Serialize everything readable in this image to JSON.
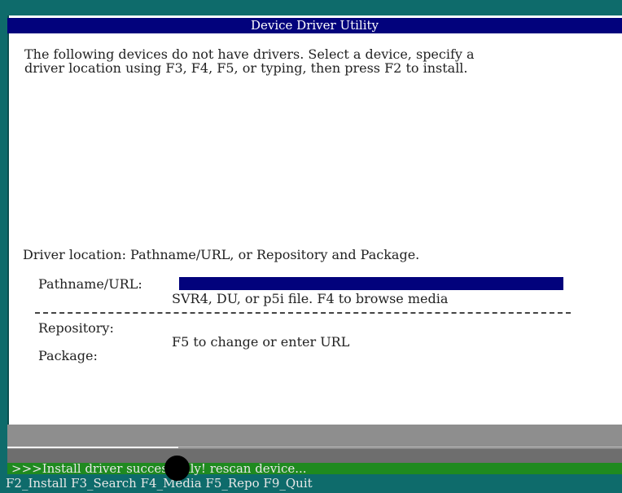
{
  "window": {
    "title": "Device Driver Utility"
  },
  "intro": {
    "line1": "The following devices do not have drivers. Select a device, specify a",
    "line2": "driver location using F3, F4, F5, or typing, then press F2 to install."
  },
  "location": {
    "heading": "Driver location: Pathname/URL, or Repository and Package.",
    "pathname_label": "Pathname/URL:",
    "pathname_value": "",
    "pathname_hint": "SVR4, DU, or p5i file. F4 to browse media",
    "repository_label": "Repository:",
    "repository_hint": "F5 to change or enter URL",
    "package_label": "Package:"
  },
  "status": {
    "message": ">>>Install driver successfully! rescan device..."
  },
  "fkeys": {
    "text": "F2_Install F3_Search F4_Media F5_Repo F9_Quit"
  },
  "colors": {
    "title_bg": "#02027c",
    "frame_bg": "#0e6b6b",
    "status_green": "#1f8a1f"
  }
}
